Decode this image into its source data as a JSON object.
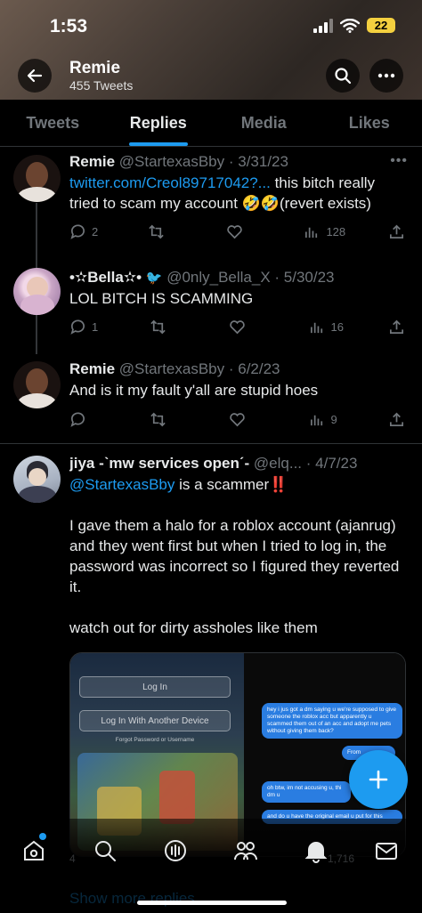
{
  "status_bar": {
    "time": "1:53",
    "battery": "22"
  },
  "header": {
    "name": "Remie",
    "tweet_count": "455 Tweets"
  },
  "tabs": [
    {
      "label": "Tweets",
      "active": false
    },
    {
      "label": "Replies",
      "active": true
    },
    {
      "label": "Media",
      "active": false
    },
    {
      "label": "Likes",
      "active": false
    }
  ],
  "tweets": [
    {
      "name": "Remie",
      "handle": "@StartexasBby",
      "date": "3/31/23",
      "link": "twitter.com/Creol89717042?...",
      "text": " this bitch really tried to scam my account 🤣🤣(revert exists)",
      "replies": "2",
      "retweets": "",
      "likes": "",
      "views": "128"
    },
    {
      "name": "•✫Bella✫•",
      "handle": "@0nly_Bella_X",
      "date": "5/30/23",
      "text": "LOL BITCH IS SCAMMING",
      "replies": "1",
      "retweets": "",
      "likes": "",
      "views": "16"
    },
    {
      "name": "Remie",
      "handle": "@StartexasBby",
      "date": "6/2/23",
      "text": "And is it my fault y'all are stupid hoes",
      "replies": "",
      "retweets": "",
      "likes": "",
      "views": "9"
    },
    {
      "name": "jiya -ˋmw services openˊ-",
      "handle": "@elq...",
      "date": "4/7/23",
      "mention": "@StartexasBby",
      "text1": " is a scammer‼️",
      "text2": "I gave them a halo for a roblox account (ajanrug) and they went first but when I tried to log in, the password was incorrect so I figured they reverted it.",
      "text3": "watch out for dirty assholes like them",
      "replies": "4",
      "views": "1,716"
    }
  ],
  "media": {
    "login_button": "Log In",
    "other_device_button": "Log In With Another Device",
    "forgot_link": "Forgot Password or Username",
    "bubble1": "hey i jus got a dm saying u we're supposed to give someone the roblox acc but apparently u scammed them out of an acc and adopt me pets without giving them back?",
    "bubble2": "From",
    "bubble3": "oh btw, im not accusing u, thi dm u",
    "bubble4": "and do u have the original email u put for this"
  },
  "footer_ghost": "Show more replies",
  "colors": {
    "accent": "#1d9bf0",
    "text": "#e7e9ea",
    "muted": "#71767b",
    "divider": "#2f3336"
  }
}
